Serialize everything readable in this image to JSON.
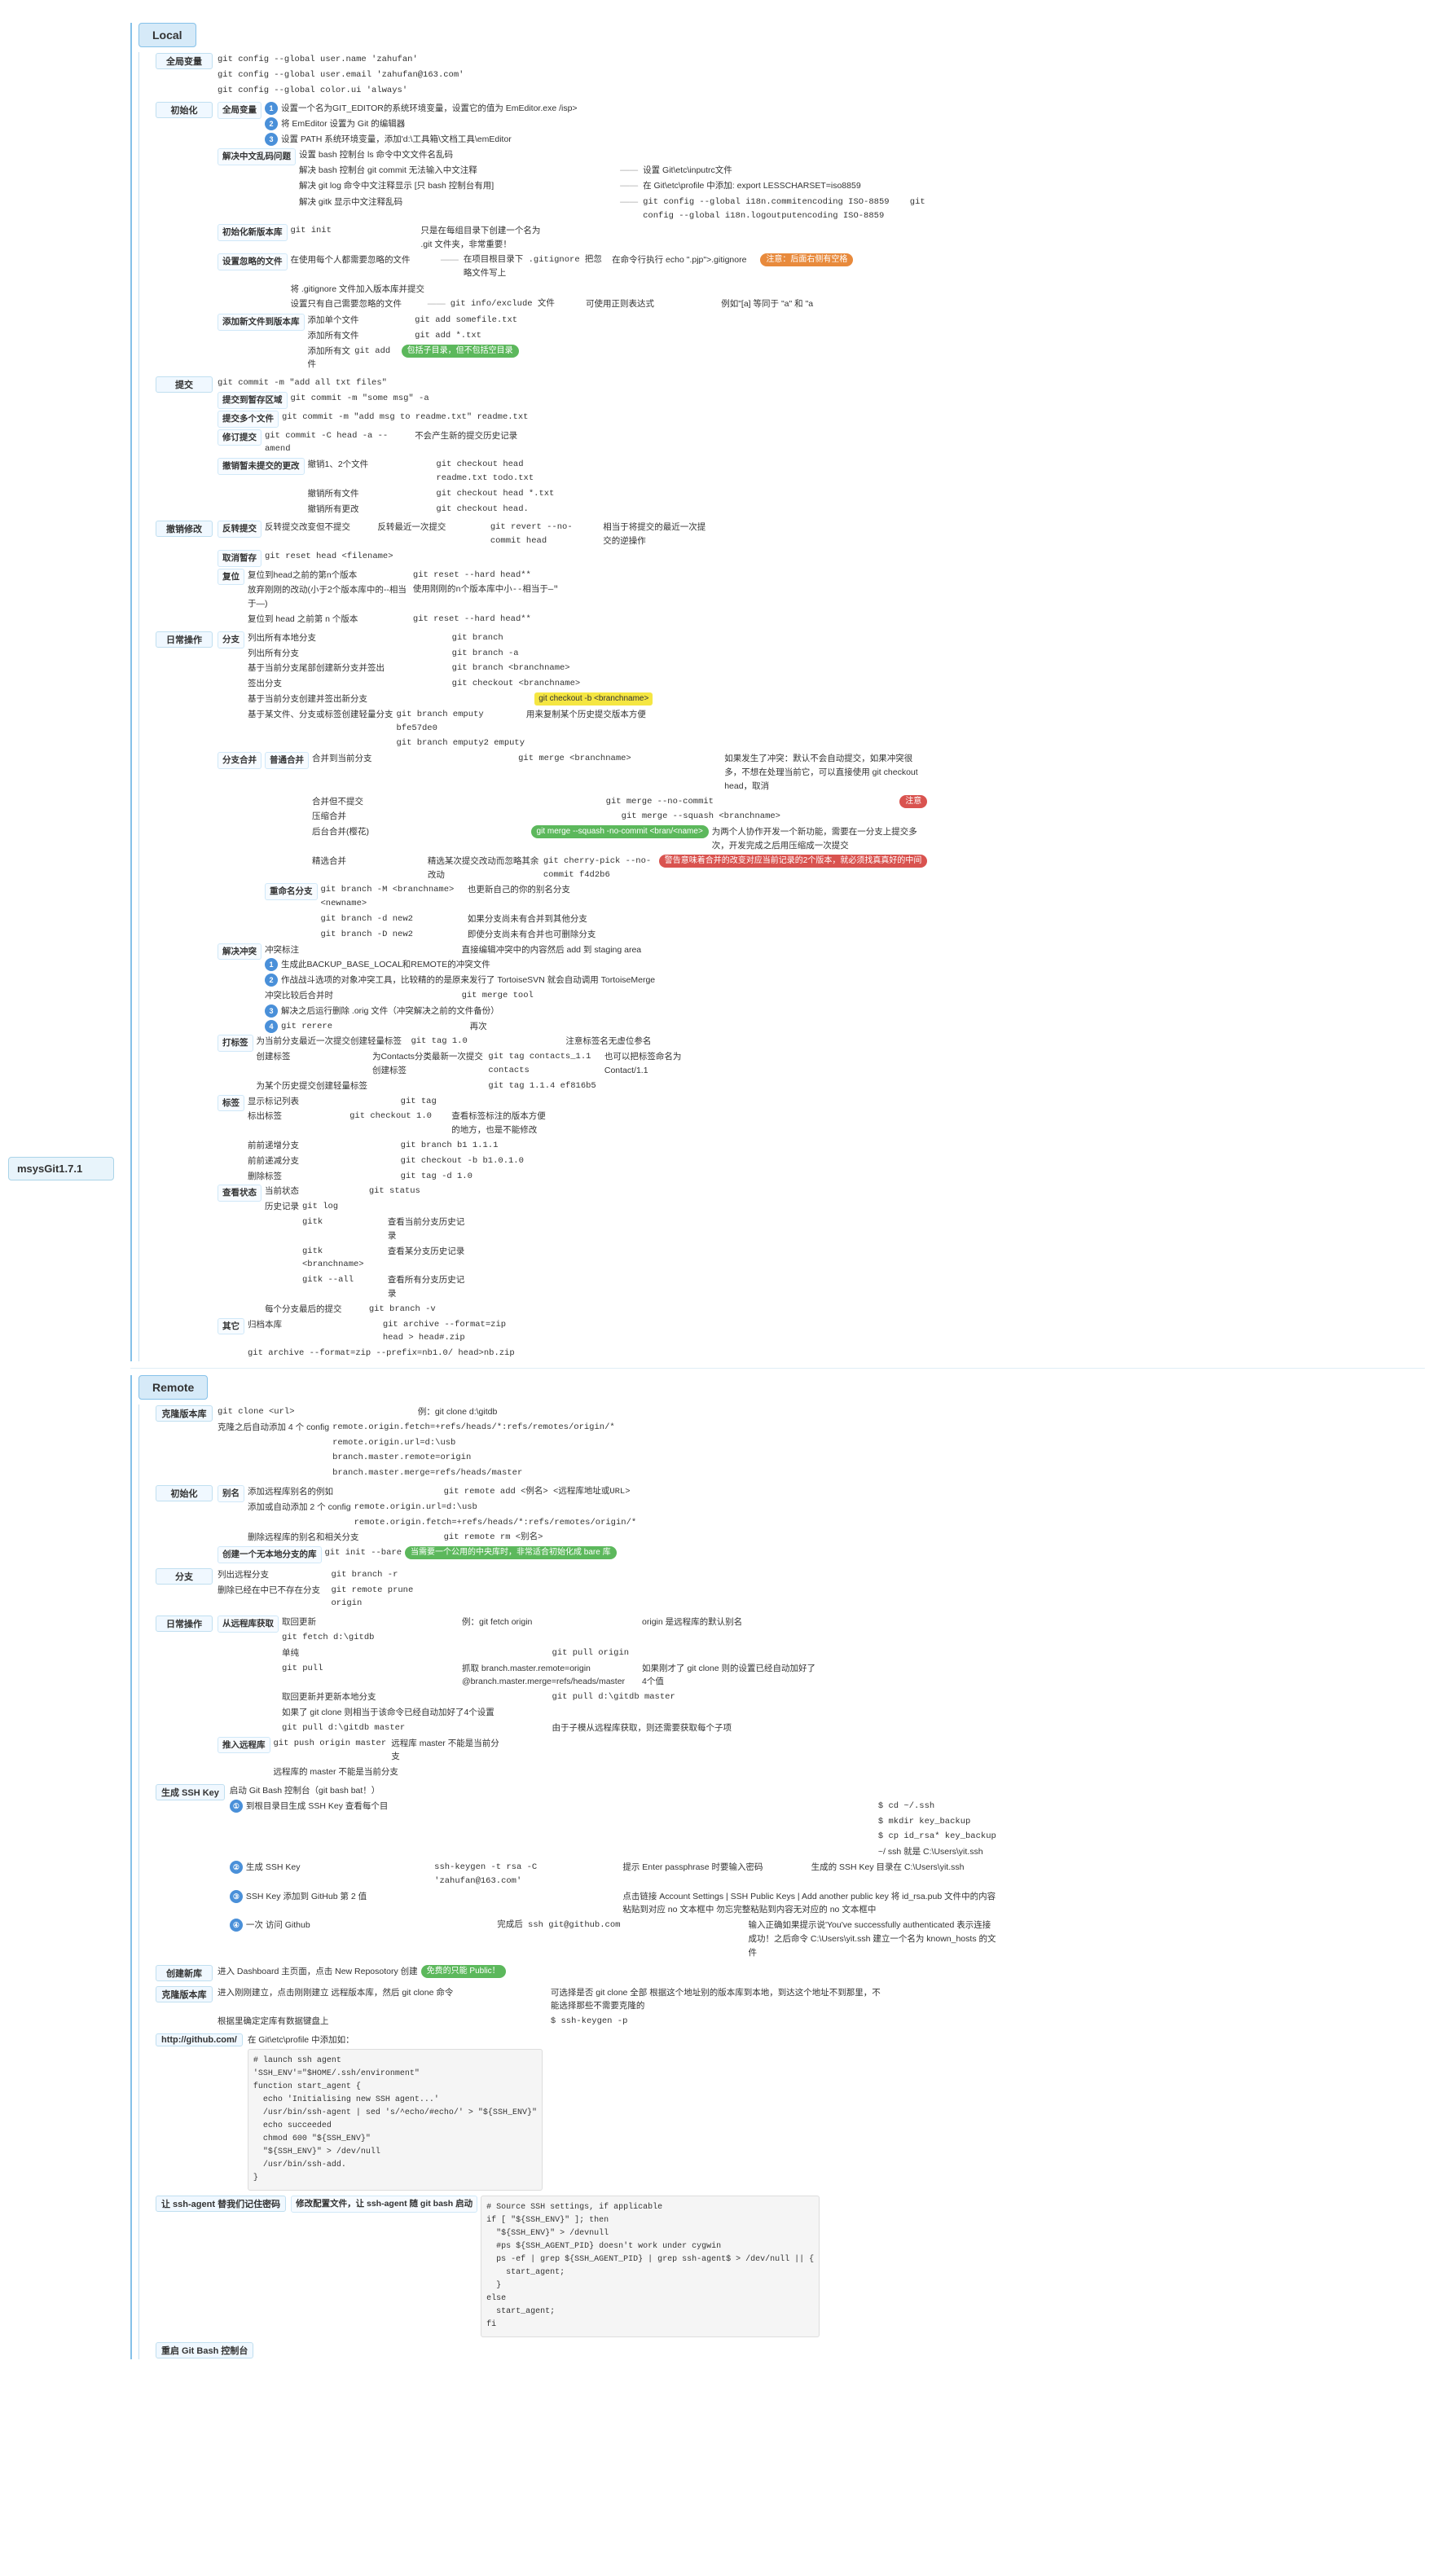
{
  "app": {
    "title": "msysGit1.7.1"
  },
  "local": {
    "label": "Local",
    "sections": [
      {
        "id": "global-var",
        "label": "全局变量",
        "items": [
          "git config --global user.name 'zahufan'",
          "git config --global user.email 'zahufan@163.com'",
          "git config --global color.ui 'always'"
        ]
      },
      {
        "id": "init",
        "label": "初始化",
        "subsections": [
          {
            "label": "全局变量",
            "items": [
              {
                "text": "设置一个名为GIT_EDITOR的系统环境变量，设置它的值为 EmEditor.exe /isp>",
                "badge": "blue",
                "badgeNum": "1"
              },
              {
                "text": "将 EmEditor 设置为 Git 的编辑器",
                "badge": "blue",
                "badgeNum": "2"
              },
              {
                "text": "设置 PATH 系统环境变量，添加'd:\\工具箱\\文档工具\\emEditor",
                "badge": "blue",
                "badgeNum": "3"
              }
            ]
          },
          {
            "label": "解决中文乱码问题",
            "items": [
              "设置 bash 控制台 ls 命令中文文件名乱码",
              "解决 bash 控制台 git commit 无法输入中文注释  设置 Git\\etc\\inputrc文件",
              "解决 git log 命令中文注释显示 [只 bash 控制台有用]  在 Git\\etc\\profile 中添加: export LESSCHARSET=iso8859",
              "解决 gitk 显示中文注释乱码  git config --global i18n.commitencoding ISO-8859  git config --global i18n.logoutputencoding ISO-8859"
            ]
          },
          {
            "label": "初始化新版本库",
            "items": [
              "git init  只是在每组目录下创建一个名为 .git 文件夹，非常重要！"
            ]
          },
          {
            "label": "设置忽略的文件",
            "items": [
              "在使用每个人都需要忽略的文件  在项目根目录下 .gitignore 把忽略文件写上  在命令行执行 echo \".pjp\">.gitignore  注意：后面右侧有空格",
              "将 .gitignore 文件加入版本库并提交",
              "设置只有自己需要忽略的文件  git info/exclude 文件  可使用正则表达式  例如\"[a] 等同于 \"a\" 和 \"a"
            ]
          },
          {
            "label": "添加新文件到版本库",
            "items": [
              "添加单个文件  git add somefile.txt",
              "添加所有文件  git add *.txt",
              "添加所有文件  git add  包括子目录，但不包括空目录"
            ]
          }
        ]
      },
      {
        "id": "commit",
        "label": "提交",
        "items": [
          "git commit -m 'add all txt files'",
          "提交到暂存区域  git commit -m 'some msg' -a",
          "提交多个文件  git commit -m 'add msg to readme.txt' readme.txt",
          "修订提交  git commit -C head -a --amend  不会产生新的提交历史记录",
          "撤销暂未提交的更改  撤销所有文件  git checkout head readme.txt todo.txt  撤销所有文件  git checkout head *.txt  撤销所有更改  git checkout head."
        ]
      },
      {
        "id": "undo",
        "label": "撤销修改",
        "subsections": [
          {
            "label": "反转提交",
            "items": [
              "反转提交改变但不提交  反转最近一次提交  git revert --no-commit head  相当于将提交的最近一次提交的逆操作"
            ]
          },
          {
            "label": "取消暂存",
            "items": [
              "git reset head <filename>"
            ]
          },
          {
            "label": "复位",
            "items": [
              "复位到head之前的第n个版本  git reset --hard head**",
              "放弃刚刚的改动(小于2个版本库中的--相当于—)",
              "复位的 head 之前第 n 个版本  git reset --hard head**"
            ]
          }
        ]
      },
      {
        "id": "branch",
        "label": "分支",
        "subsections": [
          {
            "label": "列出所有分支",
            "items": [
              "git branch"
            ]
          },
          {
            "label": "列出所有分支",
            "items": [
              "git branch -a"
            ]
          },
          {
            "label": "基于当前分支尾部创建新分支并签出",
            "items": [
              "git branch <branchname>",
              "git checkout <branchname>"
            ]
          },
          {
            "label": "签出分支",
            "items": [
              "git checkout <branchname>"
            ]
          },
          {
            "label": "基于当前分支创建并签出新分支",
            "items": [
              "git checkout -b <branchname>"
            ]
          },
          {
            "label": "基于某文件，分支或标签创建轻量分支",
            "items": [
              "git branch emputy bfe57de0  用来复制某个历史提交版本",
              "git branch emputy2 emputy"
            ]
          }
        ]
      },
      {
        "id": "daily-op",
        "label": "日常操作",
        "subsections": [
          {
            "label": "分支-普通合并",
            "items": [
              "普通合并  合并到当前分支  git merge <branchname>  如果发生了冲突：默认不会自动提交，如果冲突很多，不想在处理当前它，可以直接使用 git checkout head，取消",
              "合并但不提交  git merge --no-commit",
              "压缩合并  git merge --squash <branchname>",
              "后台合并(樱花)  git merge --squash -no-commit <bran/<name>  为两个人协作开发一个新功能，需要在一分支上提交多次，开发完成之后用压缩成一次提交",
              "精选合并  精选某次提交改动而忽略其余改动  git cherry-pick --no-commit f4d2b6  警告意味着合并的改变对应当前记录的2个版本，就必须找真真好的中间"
            ]
          },
          {
            "label": "重命名分支",
            "items": [
              "git branch -M <branchname> <newname>  也更新自己的你的别名分支",
              "git branch -d new2  如果分支尚未有合并到其他分支",
              "git branch -D new2  即使分支尚未有合并也可删除分支"
            ]
          },
          {
            "label": "解决冲突",
            "items": [
              "中突标注  直接编辑冲突中的内容然后 add 到 staging area",
              "生成此BACKUP_BASE_LOCAL和REMOTE的冲突文件  1",
              "作战战斗选项的对象冲突工具，比较精的的是原来发行了 TortoiseSVN 就会自动调用  TortoiseMerge  2",
              "解决之后运行删除 .orig 文件（中突解决之前的文件备份）  3",
              "git rerere  再次4"
            ]
          },
          {
            "label": "打标签",
            "items": [
              "为当前分支最近一次提交创建轻量标签  git tag 1.0  注意标签名无虚位参名",
              "创建标签  为Contacts分类最新一次提交创建标签  git tag contacts_1.1 contacts  也可以把标签命名为 Contact/1.1",
              "为某个历史提交创建轻量标签  git tag 1.1.4 ef816b5"
            ]
          },
          {
            "label": "标签",
            "subsections": [
              {
                "label": "显示标记列表",
                "items": [
                  "git tag"
                ]
              },
              {
                "label": "标出标签",
                "items": [
                  "git checkout 1.0  查看标签标注的版本方便的地方，也是不能修改"
                ]
              },
              {
                "label": "前前递增分支",
                "items": [
                  "git branch b1 1.1.1"
                ]
              },
              {
                "label": "前前递减分支",
                "items": [
                  "git checkout -b b1.0.1.0"
                ]
              },
              {
                "label": "删除标签",
                "items": [
                  "git tag -d 1.0"
                ]
              }
            ]
          },
          {
            "label": "查看状态",
            "subsections": [
              {
                "label": "当前状态",
                "items": [
                  "git status"
                ]
              },
              {
                "label": "历史记录",
                "items": [
                  "git log",
                  "gitk  查看当前分支历史记录",
                  "gitk <branchname>  查看某分支历史记录",
                  "gitk --all  查看所有分支历史记录"
                ]
              },
              {
                "label": "每个分支最后的提交",
                "items": [
                  "git branch -v"
                ]
              }
            ]
          },
          {
            "label": "其它",
            "items": [
              "归档本库  git archive --format=zip head > head#.zip",
              "git archive --format=zip --prefix=nb1.0/ head>nb.zip"
            ]
          }
        ]
      }
    ]
  },
  "remote": {
    "label": "Remote",
    "sections": [
      {
        "id": "clone",
        "label": "克隆版本库",
        "items": [
          "git clone <url>  例：git clone d:\\gitdb",
          "remote.origin.fetch=+refs/heads/*:refs/remotes/origin/*",
          "克隆之后自动添加 4 个 config  remote.origin.url=d:\\usb  branch.master.remote=origin  branch.master.merge=refs/heads/master"
        ]
      },
      {
        "id": "init-remote",
        "label": "初始化",
        "subsections": [
          {
            "label": "别名",
            "items": [
              "添加远程库别名的例如  git remote add <例名> <远程库地址或URL>",
              "添加或自动添加 2 个 config  remote.origin.url=d:\\usb  remote.origin.fetch=+refs/heads/*:refs/remotes/origin/*",
              "删除远程库的别名和相关分支  git remote rm <别名>"
            ]
          },
          {
            "label": "创建一个无本地分支的库",
            "items": [
              "git init --bare  当需要一个公用的中央库时，非常适合初始化成 bare 库"
            ]
          }
        ]
      },
      {
        "id": "branch-remote",
        "label": "分支",
        "items": [
          "列出远程分支  git branch -r",
          "删除已经在中已不存在分支  git remote prune origin"
        ]
      },
      {
        "id": "daily-remote",
        "label": "日常操作",
        "subsections": [
          {
            "label": "从远程库获取",
            "items": [
              "取回更新  例：git fetch origin  origin 是远程库的默认别名",
              "git fetch d:\\gitdb",
              "单纯 git pull origin",
              "git pull  抓取 branch.master.remote=origin  @branch.master.merge=refs/heads/master  如果刚才了 git clone 则的设置已经自动加好了4个值",
              "取回更新并更新本地分支  git pull d:\\gitdb master",
              "如果了 git clone 则相当于该命令已经自动加好了4个设置",
              "git pull d:\\gitdb master  由于子模从远程库获取，则还需要获取每个子项"
            ]
          },
          {
            "label": "推入远程库",
            "items": [
              "git push origin master  远程库 master 不能是当前分支",
              "远程库的 master 不能是当前分支"
            ]
          }
        ]
      },
      {
        "id": "ssh",
        "label": "生成 SSH Key",
        "items": [
          "启动 Git Bash 控制台（git bash bat！）",
          "① 到根目录目生成 SSH Key 查看每个目  ~/ ssh 就是 C:\\Users\\yit.ssh",
          "② 生成 SSH Key  ssh-keygen -t rsa -C 'zahufan@163.com'  生成的 SSH Key 目录在 C:\\Users\\yit.ssh",
          "③ SSH Key 添加到 GitHub 第 2 值  点击链接 Account Settings | SSH Public Keys | Add another public key  将 id_rsa.pub 文件中的内容粘贴到对应 no 文本框中",
          "④ 一次 访问 Github  完成后 ssh git@github.com  输入正确如果提示说'You've successfully authenticated 表示连接成功！之后命令 C:\\Users\\yit.ssh 建立一个名为 known_hosts 的文件"
        ]
      },
      {
        "id": "create-remote",
        "label": "创建新库",
        "items": [
          "进入 Dashboard 主页面，点击 New Reposotory 创建  免费的只能 Public！"
        ]
      },
      {
        "id": "clone-remote",
        "label": "克隆版本库",
        "items": [
          "进入刚刚建立，点击刚刚建立 远程版本库，然后 git clone 命令  可选择是否 git clone 全部  根据这个地址别的版本库到本地，到达这个地址不到那里，不能选择那些不需要克隆的",
          "根据里确定定库有数据键盘上  $ ssh-keygen -p"
        ]
      },
      {
        "id": "github",
        "label": "http://github.com/",
        "items": [
          "在 Git\\etc\\profile 中添加如：  # launch ssh agent  'SSH_ENV'=\"$HOME/.ssh/environment\"  function start_agent {  echo 'Initialising new SSH agent...'  /usr/bin/ssh-agent | sed 's/^echo/#echo/' > \"${SSH_ENV}\"  echo succeeded  chmod 600 \"${SSH_ENV}\"  \"${SSH_ENV}\" > /dev/null  /usr/bin/ssh-add."
        ]
      },
      {
        "id": "ssh-agent",
        "label": "让 ssh-agent 替我们记住密码",
        "subsections": [
          {
            "label": "修改配置文件，让 ssh-agent 随 git bash 启动",
            "items": [
              "# Source SSH settings, if applicable  if [ \"${SSH_ENV}\" ]; then  \"${SSH_ENV}\" > /devnull  #ps ${SSH_AGENT_PID} doesn't work under cygwin  ps -ef | grep ${SSH_AGENT_PID} | grep ssh-agent$ > /dev/null || {  start_agent;  }  else  start_agent;  fi"
            ]
          }
        ]
      },
      {
        "id": "reopen",
        "label": "重启 Git Bash 控制台"
      }
    ]
  }
}
